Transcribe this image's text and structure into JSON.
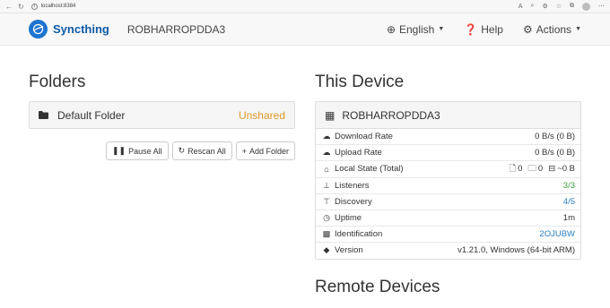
{
  "browser": {
    "url": "localhost:8384"
  },
  "navbar": {
    "brand": "Syncthing",
    "device_name": "ROBHARROPDDA3",
    "language": "English",
    "help": "Help",
    "actions": "Actions"
  },
  "folders": {
    "title": "Folders",
    "items": [
      {
        "name": "Default Folder",
        "status": "Unshared"
      }
    ],
    "buttons": {
      "pause_all": "Pause All",
      "rescan_all": "Rescan All",
      "add_folder": "Add Folder"
    }
  },
  "this_device": {
    "title": "This Device",
    "name": "ROBHARROPDDA3",
    "rows": [
      {
        "icon": "cloud-download-icon",
        "label": "Download Rate",
        "value": "0 B/s (0 B)"
      },
      {
        "icon": "cloud-upload-icon",
        "label": "Upload Rate",
        "value": "0 B/s (0 B)"
      },
      {
        "icon": "home-icon",
        "label": "Local State (Total)"
      },
      {
        "icon": "sitemap-icon",
        "label": "Listeners",
        "value": "3/3"
      },
      {
        "icon": "signpost-icon",
        "label": "Discovery",
        "value": "4/5"
      },
      {
        "icon": "clock-icon",
        "label": "Uptime",
        "value": "1m"
      },
      {
        "icon": "qrcode-icon",
        "label": "Identification",
        "value": "2OJUBW"
      },
      {
        "icon": "tag-icon",
        "label": "Version",
        "value": "v1.21.0, Windows (64-bit ARM)"
      }
    ],
    "local_state": {
      "files": "0",
      "folders": "0",
      "size": "~0 B"
    }
  },
  "remote_devices": {
    "title": "Remote Devices"
  },
  "colors": {
    "brand": "#0e5aa7",
    "unshared": "#e09a2b",
    "ok": "#3c9e3c",
    "link": "#2a7fc1"
  }
}
